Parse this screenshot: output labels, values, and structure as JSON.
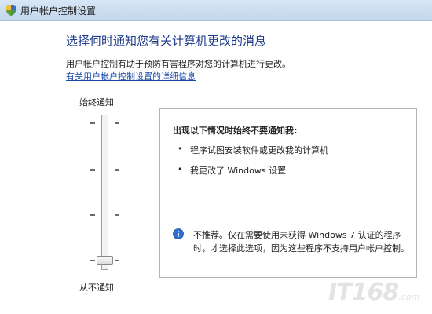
{
  "window": {
    "title": "用户帐户控制设置",
    "icon": "shield-icon"
  },
  "main": {
    "heading": "选择何时通知您有关计算机更改的消息",
    "description": "用户帐户控制有助于预防有害程序对您的计算机进行更改。",
    "link_text": "有关用户帐户控制设置的详细信息"
  },
  "slider": {
    "top_label": "始终通知",
    "bottom_label": "从不通知",
    "levels": 4,
    "selected_level": 1
  },
  "info_box": {
    "title": "出现以下情况时始终不要通知我:",
    "items": [
      "程序试图安装软件或更改我的计算机",
      "我更改了 Windows 设置"
    ],
    "note": "不推荐。仅在需要使用未获得 Windows 7 认证的程序时，才选择此选项，因为这些程序不支持用户帐户控制。",
    "note_icon": "info-icon"
  },
  "watermark": {
    "brand": "IT168",
    "suffix": ".com"
  }
}
